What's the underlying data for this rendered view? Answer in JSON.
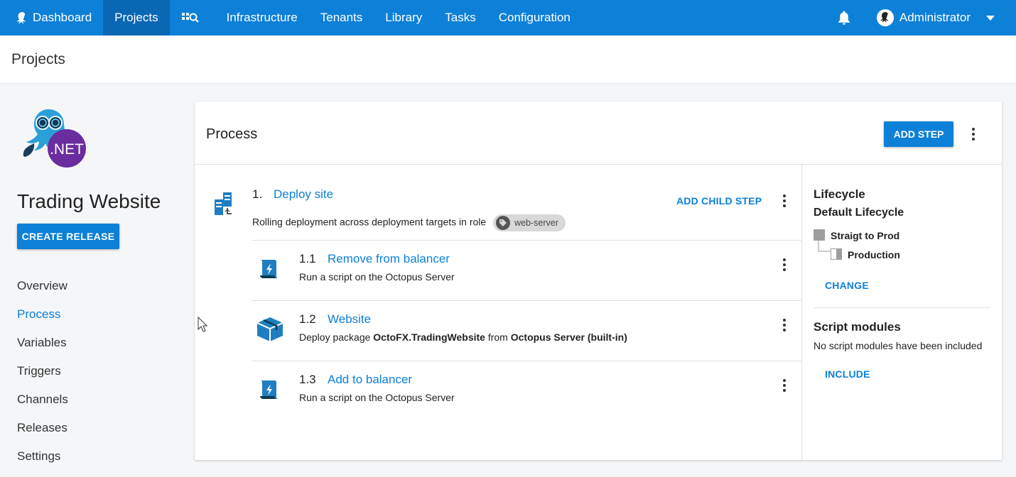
{
  "nav": {
    "items": [
      {
        "label": "Dashboard",
        "icon": "octopus-icon"
      },
      {
        "label": "Projects"
      },
      {
        "label": "",
        "icon": "search-icon"
      },
      {
        "label": "Infrastructure"
      },
      {
        "label": "Tenants"
      },
      {
        "label": "Library"
      },
      {
        "label": "Tasks"
      },
      {
        "label": "Configuration"
      }
    ],
    "active": "Projects",
    "user": "Administrator",
    "notifications_icon": "bell-icon",
    "colors": {
      "bar": "#0d80d8",
      "active": "#0a67b3"
    }
  },
  "page": {
    "title": "Projects"
  },
  "sidebar": {
    "project_name": "Trading Website",
    "logo_text": ".NET",
    "create_release_label": "CREATE RELEASE",
    "items": [
      "Overview",
      "Process",
      "Variables",
      "Triggers",
      "Channels",
      "Releases",
      "Settings"
    ],
    "active_item": "Process"
  },
  "process": {
    "title": "Process",
    "add_step_label": "ADD STEP",
    "add_child_label": "ADD CHILD STEP",
    "parent": {
      "number": "1.",
      "name": "Deploy site",
      "description": "Rolling deployment across deployment targets in role",
      "role": "web-server",
      "icon": "deployment-targets-icon"
    },
    "children": [
      {
        "number": "1.1",
        "name": "Remove from balancer",
        "desc_prefix": "Run a script on the Octopus Server",
        "icon": "script-icon"
      },
      {
        "number": "1.2",
        "name": "Website",
        "desc_prefix": "Deploy package ",
        "package": "OctoFX.TradingWebsite",
        "desc_mid": " from ",
        "feed": "Octopus Server (built-in)",
        "icon": "package-icon"
      },
      {
        "number": "1.3",
        "name": "Add to balancer",
        "desc_prefix": "Run a script on the Octopus Server",
        "icon": "script-icon"
      }
    ]
  },
  "lifecycle": {
    "heading": "Lifecycle",
    "name": "Default Lifecycle",
    "phase": "Straigt to Prod",
    "environment": "Production",
    "change_label": "CHANGE"
  },
  "script_modules": {
    "heading": "Script modules",
    "empty_text": "No script modules have been included",
    "include_label": "INCLUDE"
  }
}
